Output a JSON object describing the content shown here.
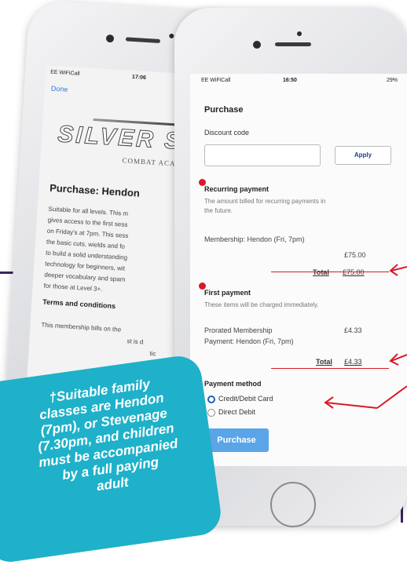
{
  "back_phone": {
    "status": {
      "carrier": "EE WiFiCall",
      "time": "17:06"
    },
    "done_label": "Done",
    "logo": {
      "main": "SILVER SA",
      "sub": "COMBAT ACA"
    },
    "heading": "Purchase: Hendon",
    "description": [
      "Suitable for all levels. This m",
      "gives access to the first sess",
      "on Friday's at 7pm. This sess",
      "the basic cuts, wields and fo",
      "to build a solid understanding",
      "technology for beginners, wit",
      "deeper vocabulary and spam",
      "for those at Level 3+."
    ],
    "terms_heading": "Terms and conditions",
    "terms_lines": [
      "This membership bills on the",
      "st is d",
      "tic"
    ]
  },
  "front_phone": {
    "status": {
      "carrier": "EE WiFiCall",
      "time": "16:50",
      "battery": "29%"
    },
    "title": "Purchase",
    "discount_label": "Discount code",
    "discount_placeholder": "",
    "apply_label": "Apply",
    "recurring": {
      "heading": "Recurring payment",
      "note": [
        "The amount billed for recurring payments in",
        "the future."
      ],
      "item": "Membership: Hendon (Fri, 7pm)",
      "amount": "£75.00",
      "total_label": "Total",
      "total_value": "£75.00"
    },
    "first": {
      "heading": "First payment",
      "note": "These items will be charged immediately.",
      "item_line1": "Prorated Membership",
      "item_line2": "Payment: Hendon (Fri, 7pm)",
      "amount": "£4.33",
      "total_label": "Total",
      "total_value": "£4.33"
    },
    "payment_method": {
      "heading": "Payment method",
      "options": [
        {
          "label": "Credit/Debit Card",
          "selected": true
        },
        {
          "label": "Direct Debit",
          "selected": false
        }
      ]
    },
    "purchase_label": "Purchase"
  },
  "badge": {
    "lines": [
      "†Suitable family",
      "classes are Hendon",
      "(7pm), or Stevenage",
      "(7.30pm, and children",
      "must be accompanied",
      "by a full paying",
      "adult"
    ]
  },
  "colors": {
    "accent_red": "#d71a2a",
    "button_blue": "#5aa5e8",
    "badge_teal": "#1eb1c9",
    "frame_purple": "#3b2563"
  }
}
